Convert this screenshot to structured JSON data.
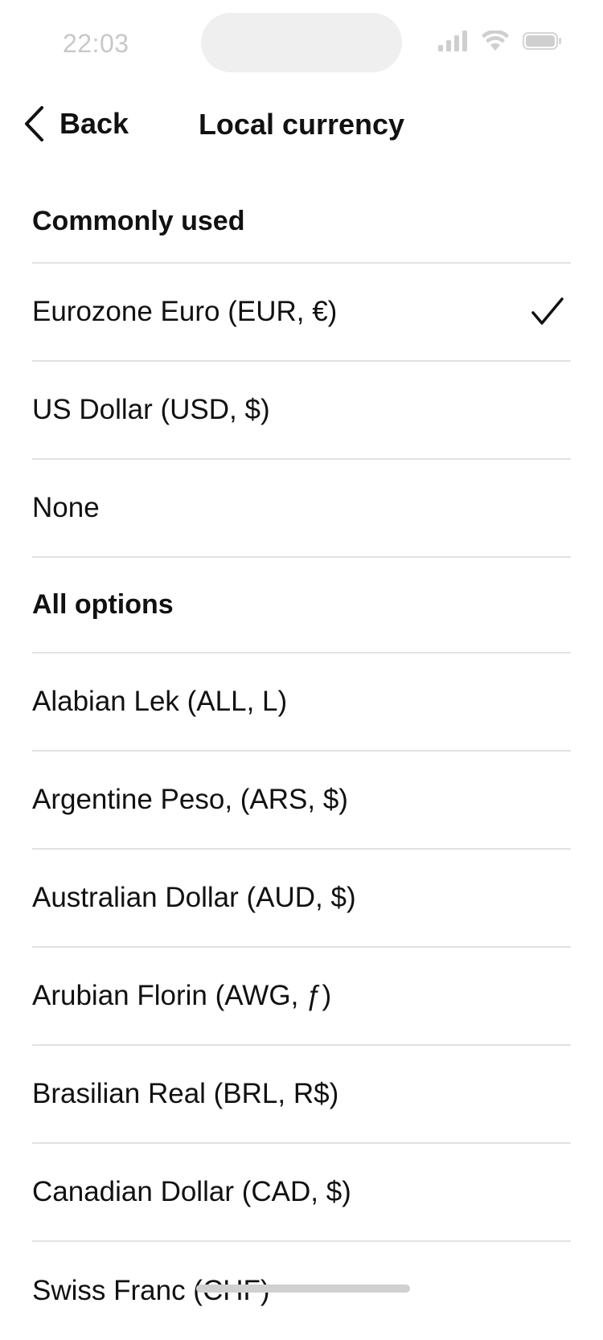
{
  "status_bar": {
    "time": "22:03",
    "icons": [
      "signal-icon",
      "wifi-icon",
      "battery-icon"
    ]
  },
  "nav": {
    "back_label": "Back",
    "title": "Local currency",
    "back_icon": "chevron-left-icon"
  },
  "sections": [
    {
      "header": "Commonly used",
      "items": [
        {
          "label": "Eurozone Euro (EUR, €)",
          "selected": true
        },
        {
          "label": "US Dollar (USD, $)",
          "selected": false
        },
        {
          "label": "None",
          "selected": false
        }
      ]
    },
    {
      "header": "All options",
      "items": [
        {
          "label": "Alabian Lek (ALL, L)",
          "selected": false
        },
        {
          "label": "Argentine Peso, (ARS, $)",
          "selected": false
        },
        {
          "label": "Australian Dollar (AUD, $)",
          "selected": false
        },
        {
          "label": "Arubian Florin (AWG, ƒ)",
          "selected": false
        },
        {
          "label": "Brasilian Real (BRL, R$)",
          "selected": false
        },
        {
          "label": "Canadian Dollar (CAD, $)",
          "selected": false
        },
        {
          "label": "Swiss Franc (CHF)",
          "selected": false
        }
      ]
    }
  ],
  "colors": {
    "text": "#111111",
    "divider": "#e2e2e2",
    "status_text": "#c8c8c8"
  }
}
